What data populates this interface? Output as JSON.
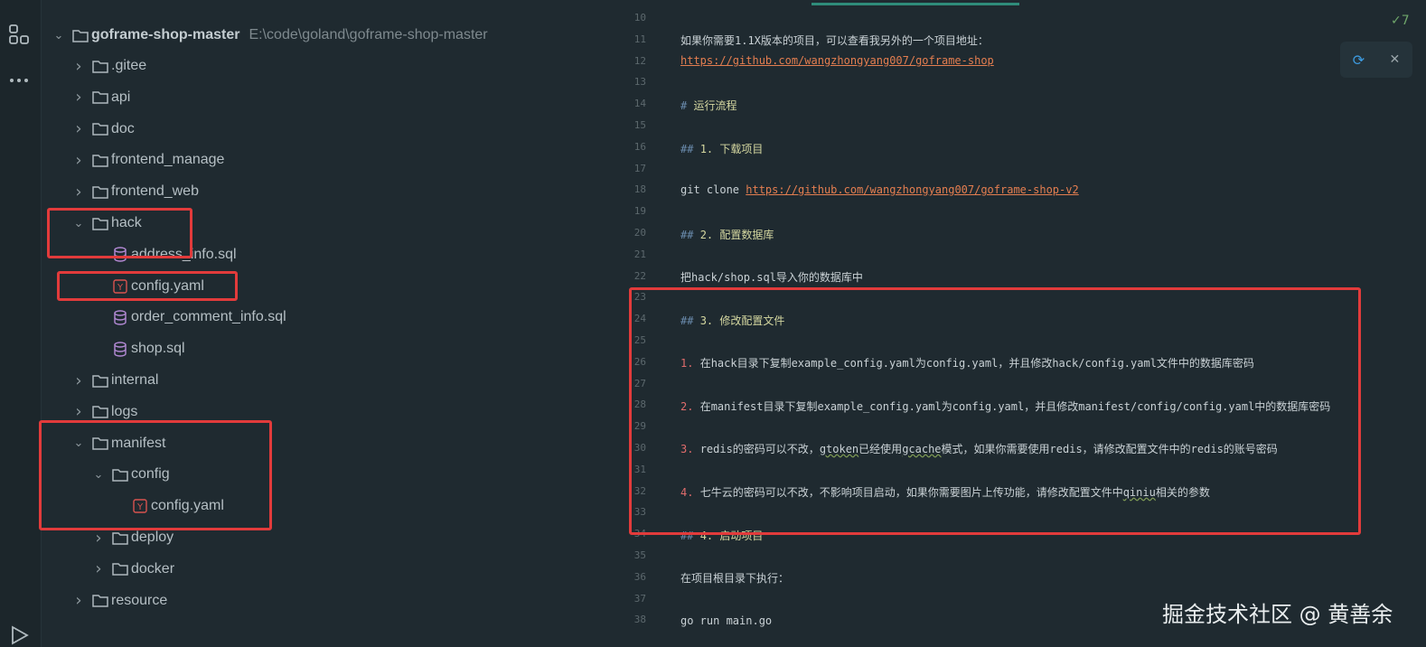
{
  "activity": {
    "structure_icon": "structure-icon",
    "more_icon": "more-icon",
    "run_icon": "run-icon"
  },
  "tree": {
    "root": {
      "name": "goframe-shop-master",
      "path": "E:\\code\\goland\\goframe-shop-master"
    },
    "items": [
      {
        "label": ".gitee",
        "type": "folder",
        "expanded": false
      },
      {
        "label": "api",
        "type": "folder",
        "expanded": false
      },
      {
        "label": "doc",
        "type": "folder",
        "expanded": false
      },
      {
        "label": "frontend_manage",
        "type": "folder",
        "expanded": false
      },
      {
        "label": "frontend_web",
        "type": "folder",
        "expanded": false
      },
      {
        "label": "hack",
        "type": "folder",
        "expanded": true
      },
      {
        "label": "address_info.sql",
        "type": "sql"
      },
      {
        "label": "config.yaml",
        "type": "yaml"
      },
      {
        "label": "order_comment_info.sql",
        "type": "sql"
      },
      {
        "label": "shop.sql",
        "type": "sql"
      },
      {
        "label": "internal",
        "type": "folder",
        "expanded": false
      },
      {
        "label": "logs",
        "type": "folder",
        "expanded": false
      },
      {
        "label": "manifest",
        "type": "folder",
        "expanded": true
      },
      {
        "label": "config",
        "type": "folder",
        "expanded": true
      },
      {
        "label": "config.yaml",
        "type": "yaml"
      },
      {
        "label": "deploy",
        "type": "folder",
        "expanded": false
      },
      {
        "label": "docker",
        "type": "folder",
        "expanded": false
      },
      {
        "label": "resource",
        "type": "folder",
        "expanded": false
      }
    ]
  },
  "editor": {
    "line_numbers": [
      "10",
      "11",
      "12",
      "13",
      "14",
      "15",
      "16",
      "17",
      "18",
      "19",
      "20",
      "21",
      "22",
      "23",
      "24",
      "25",
      "26",
      "27",
      "28",
      "29",
      "30",
      "31",
      "32",
      "33",
      "34",
      "35",
      "36",
      "37",
      "38"
    ],
    "lines": {
      "l11": "如果你需要1.1X版本的项目，可以查看我另外的一个项目地址：",
      "l12_link": "https://github.com/wangzhongyang007/goframe-shop",
      "l14_hash": "#",
      "l14_text": "运行流程",
      "l16_hash": "##",
      "l16_text": "1. 下载项目",
      "l18_cmd": "git clone ",
      "l18_link": "https://github.com/wangzhongyang007/goframe-shop-v2",
      "l20_hash": "##",
      "l20_text": "2. 配置数据库",
      "l22": "把hack/shop.sql导入你的数据库中",
      "l24_hash": "##",
      "l24_text": "3. 修改配置文件",
      "l26_num": "1.",
      "l26_text": "在hack目录下复制example_config.yaml为config.yaml，并且修改hack/config.yaml文件中的数据库密码",
      "l28_num": "2.",
      "l28_text": "在manifest目录下复制example_config.yaml为config.yaml，并且修改manifest/config/config.yaml中的数据库密码",
      "l30_num": "3.",
      "l30_a": "redis的密码可以不改，",
      "l30_b": "gtoken",
      "l30_c": "已经使用",
      "l30_d": "gcache",
      "l30_e": "模式，如果你需要使用redis，请修改配置文件中的redis的账号密码",
      "l32_num": "4.",
      "l32_a": "七牛云的密码可以不改，不影响项目启动，如果你需要图片上传功能，请修改配置文件中",
      "l32_b": "qiniu",
      "l32_c": "相关的参数",
      "l34_hash": "##",
      "l34_text": "4. 启动项目",
      "l36": "在项目根目录下执行：",
      "l38": "go run main.go"
    },
    "inspection_count": "7",
    "reload_icon": "reload-icon",
    "close_icon": "close-icon"
  },
  "watermark": "掘金技术社区 @ 黄善余",
  "colors": {
    "highlight_box": "#e23b3b",
    "link": "#e47e50",
    "background": "#1f2a30"
  }
}
